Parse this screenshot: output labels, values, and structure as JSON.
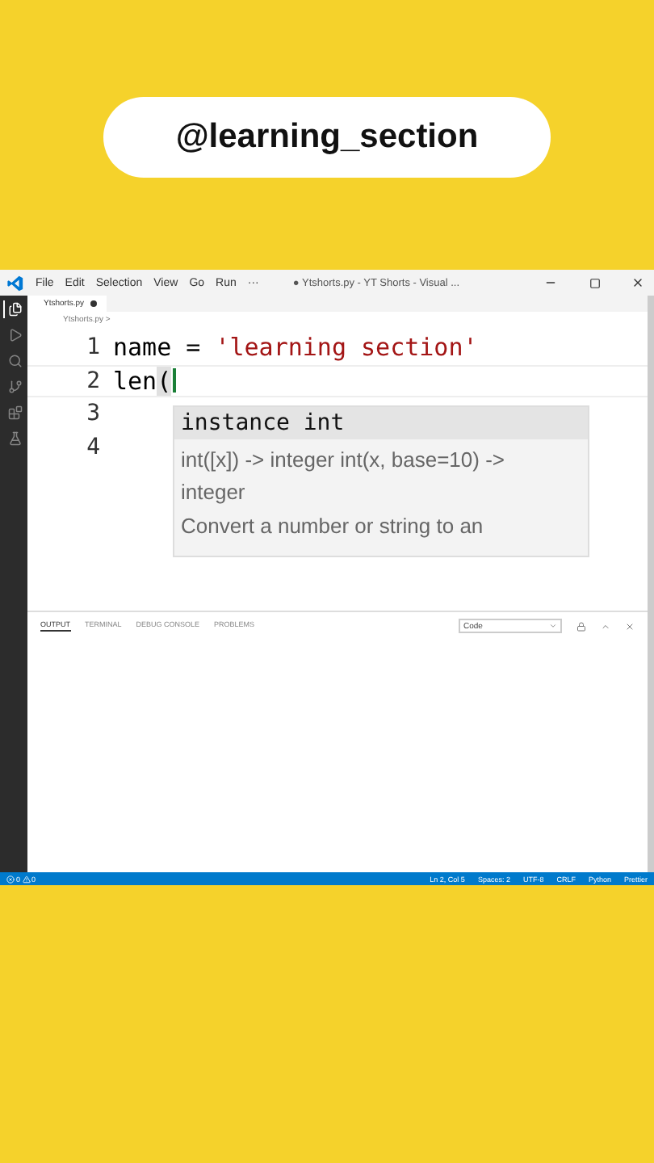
{
  "banner": {
    "handle": "@learning_section"
  },
  "menu": [
    "File",
    "Edit",
    "Selection",
    "View",
    "Go",
    "Run",
    "···"
  ],
  "window_title": "● Ytshorts.py - YT Shorts - Visual ...",
  "activity_bar": [
    {
      "selected": true
    },
    {
      "selected": false
    },
    {
      "selected": false
    },
    {
      "selected": false
    },
    {
      "selected": false
    },
    {
      "selected": false
    }
  ],
  "editor_tab": {
    "label": "Ytshorts.py",
    "modified": true
  },
  "breadcrumb": "Ytshorts.py >",
  "code_lines": [
    {
      "number": "1",
      "tokens": [
        {
          "kind": "plain",
          "text": "name = "
        },
        {
          "kind": "string",
          "text": "'learning section'"
        }
      ]
    },
    {
      "number": "2",
      "tokens": [
        {
          "kind": "plain",
          "text": "len"
        },
        {
          "kind": "bracket",
          "text": "("
        }
      ],
      "cursor": true
    },
    {
      "number": "3"
    },
    {
      "number": "4"
    }
  ],
  "suggestion": {
    "label": "instance int",
    "signature": "int([x]) -> integer int(x, base=10) -> integer",
    "doc": "Convert a number or string to an"
  },
  "panel": {
    "tabs": [
      {
        "label": "OUTPUT",
        "selected": true
      },
      {
        "label": "TERMINAL",
        "selected": false
      },
      {
        "label": "DEBUG CONSOLE",
        "selected": false
      },
      {
        "label": "PROBLEMS",
        "selected": false
      }
    ],
    "dropdown": "Code"
  },
  "status_bar": {
    "errors": "0",
    "warnings": "0",
    "items": [
      "Ln 2, Col 5",
      "Spaces: 2",
      "UTF-8",
      "CRLF",
      "Python",
      "Prettier"
    ]
  }
}
